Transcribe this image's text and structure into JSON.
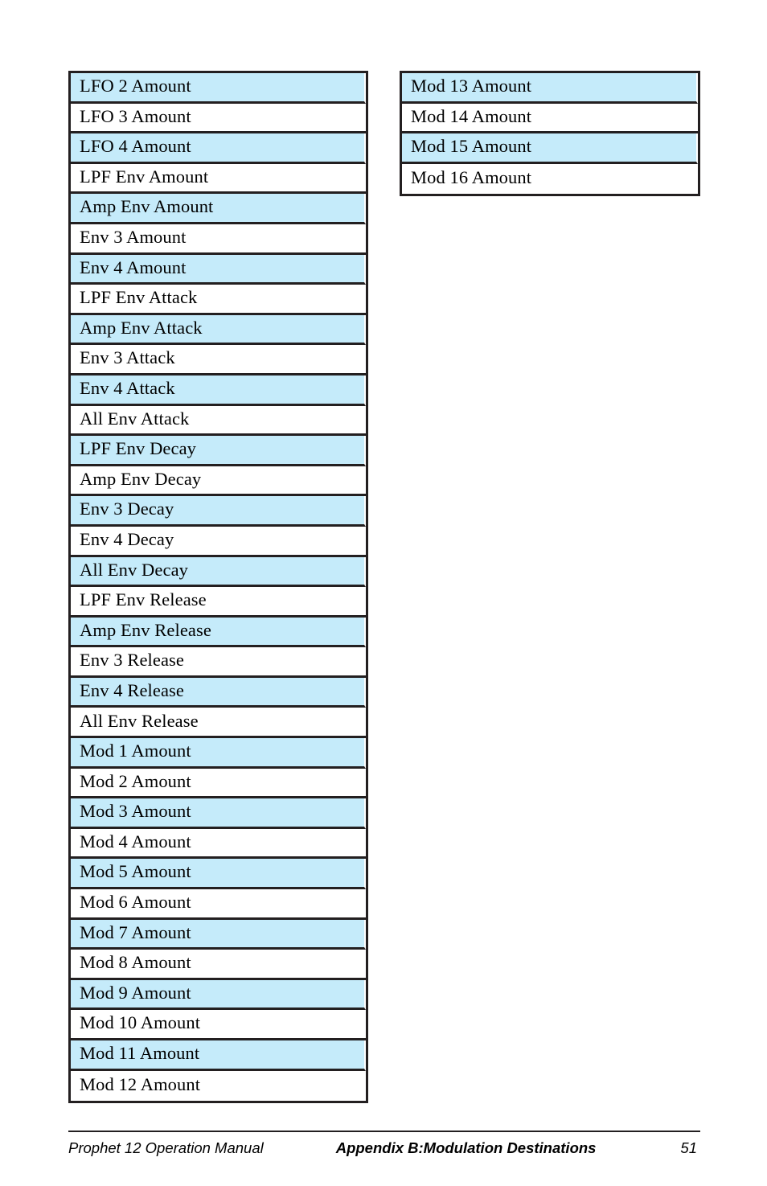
{
  "document": {
    "type": "appendix-table-page",
    "accent_row_color": "#c5ebfa",
    "rule_color": "#231f20"
  },
  "tables": {
    "left_column": {
      "name": "modulation-destinations-continued-left",
      "rows": [
        {
          "label": "LFO 2 Amount",
          "shaded": true
        },
        {
          "label": "LFO 3 Amount",
          "shaded": false
        },
        {
          "label": "LFO 4 Amount",
          "shaded": true
        },
        {
          "label": "LPF Env Amount",
          "shaded": false
        },
        {
          "label": "Amp Env Amount",
          "shaded": true
        },
        {
          "label": "Env 3 Amount",
          "shaded": false
        },
        {
          "label": "Env 4 Amount",
          "shaded": true
        },
        {
          "label": "LPF Env Attack",
          "shaded": false
        },
        {
          "label": "Amp Env Attack",
          "shaded": true
        },
        {
          "label": "Env 3 Attack",
          "shaded": false
        },
        {
          "label": "Env 4 Attack",
          "shaded": true
        },
        {
          "label": "All Env Attack",
          "shaded": false
        },
        {
          "label": "LPF Env Decay",
          "shaded": true
        },
        {
          "label": "Amp Env Decay",
          "shaded": false
        },
        {
          "label": "Env 3 Decay",
          "shaded": true
        },
        {
          "label": "Env 4 Decay",
          "shaded": false
        },
        {
          "label": "All Env Decay",
          "shaded": true
        },
        {
          "label": "LPF Env Release",
          "shaded": false
        },
        {
          "label": "Amp Env Release",
          "shaded": true
        },
        {
          "label": "Env 3 Release",
          "shaded": false
        },
        {
          "label": "Env 4 Release",
          "shaded": true
        },
        {
          "label": "All Env Release",
          "shaded": false
        },
        {
          "label": "Mod 1 Amount",
          "shaded": true
        },
        {
          "label": "Mod 2 Amount",
          "shaded": false
        },
        {
          "label": "Mod 3 Amount",
          "shaded": true
        },
        {
          "label": "Mod 4 Amount",
          "shaded": false
        },
        {
          "label": "Mod 5 Amount",
          "shaded": true
        },
        {
          "label": "Mod 6 Amount",
          "shaded": false
        },
        {
          "label": "Mod 7 Amount",
          "shaded": true
        },
        {
          "label": "Mod 8 Amount",
          "shaded": false
        },
        {
          "label": "Mod 9 Amount",
          "shaded": true
        },
        {
          "label": "Mod 10 Amount",
          "shaded": false
        },
        {
          "label": "Mod 11 Amount",
          "shaded": true
        },
        {
          "label": "Mod 12 Amount",
          "shaded": false
        }
      ]
    },
    "right_column": {
      "name": "modulation-destinations-continued-right",
      "rows": [
        {
          "label": "Mod 13 Amount",
          "shaded": true
        },
        {
          "label": "Mod 14 Amount",
          "shaded": false
        },
        {
          "label": "Mod 15 Amount",
          "shaded": true
        },
        {
          "label": "Mod 16 Amount",
          "shaded": false
        }
      ]
    }
  },
  "footer": {
    "manual_title": "Prophet 12 Operation Manual",
    "section_title": "Appendix B:Modulation Destinations",
    "page_number": "51"
  }
}
